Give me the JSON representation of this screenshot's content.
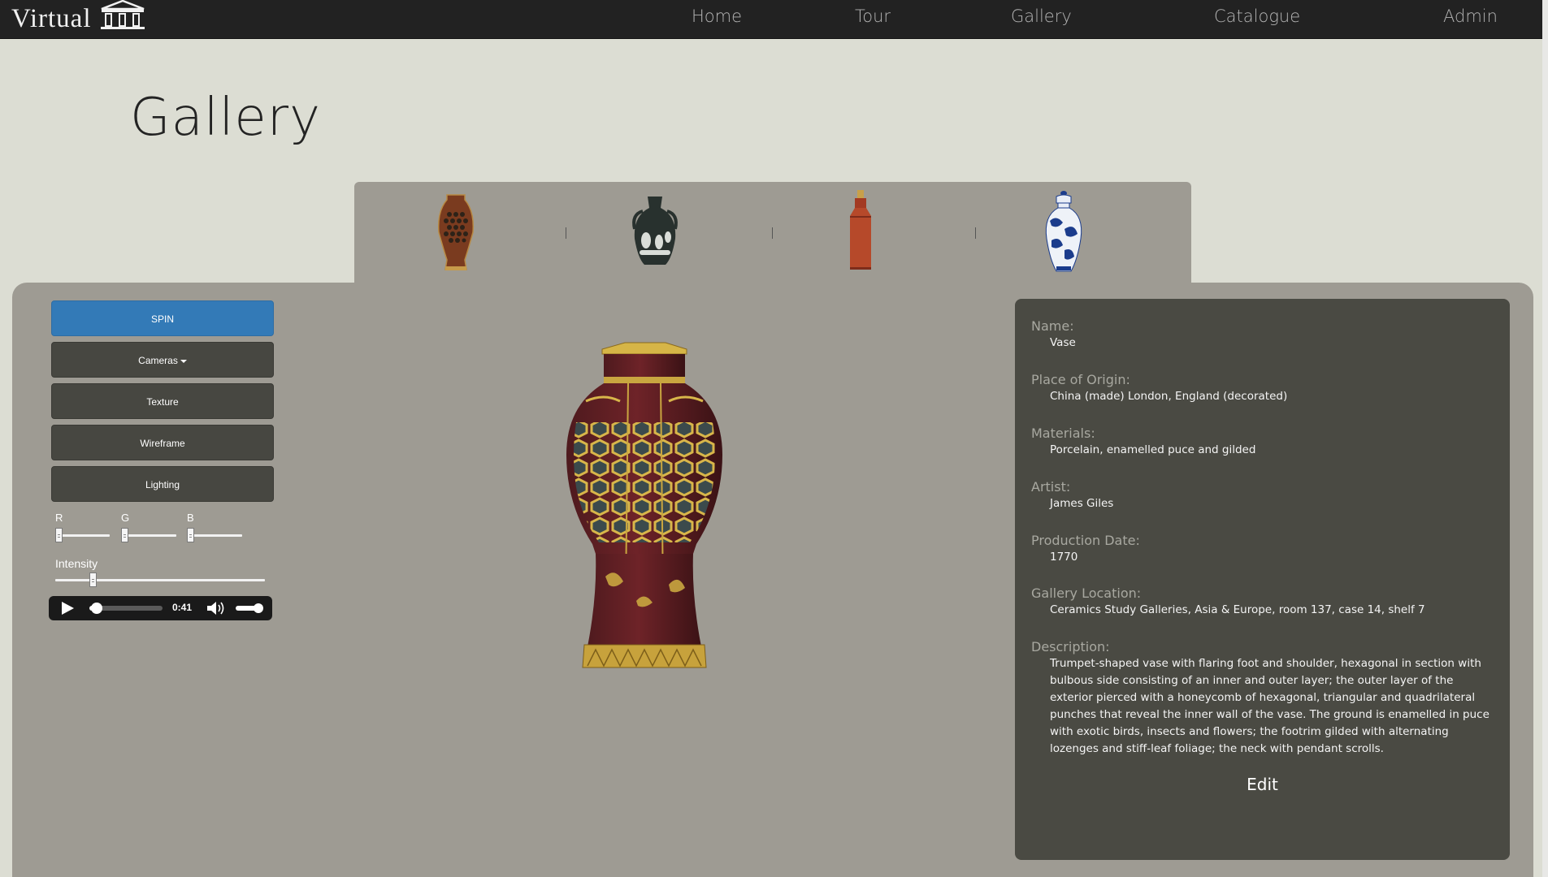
{
  "brand": {
    "name": "Virtual",
    "logo_icon": "museum-columns-icon"
  },
  "nav": {
    "items": [
      {
        "label": "Home"
      },
      {
        "label": "Tour"
      },
      {
        "label": "Gallery"
      },
      {
        "label": "Catalogue"
      },
      {
        "label": "Admin"
      }
    ]
  },
  "page": {
    "title": "Gallery"
  },
  "thumbnails": [
    {
      "name": "reticulated-vase",
      "icon": "vase-thumbnail"
    },
    {
      "name": "portland-vase",
      "icon": "vase-thumbnail"
    },
    {
      "name": "red-bottle",
      "icon": "bottle-thumbnail"
    },
    {
      "name": "blue-white-jar",
      "icon": "jar-thumbnail"
    }
  ],
  "controls": {
    "spin_label": "SPIN",
    "cameras_label": "Cameras",
    "texture_label": "Texture",
    "wireframe_label": "Wireframe",
    "lighting_label": "Lighting",
    "rgb": {
      "r_label": "R",
      "g_label": "G",
      "b_label": "B"
    },
    "intensity_label": "Intensity",
    "intensity_fraction": 0.18
  },
  "audio": {
    "time": "0:41",
    "progress_fraction": 0.1,
    "play_icon": "play-icon",
    "volume_icon": "volume-icon"
  },
  "info": {
    "name_label": "Name:",
    "name": "Vase",
    "origin_label": "Place of Origin:",
    "origin": "China (made) London, England (decorated)",
    "materials_label": "Materials:",
    "materials": "Porcelain, enamelled puce and gilded",
    "artist_label": "Artist:",
    "artist": "James Giles",
    "date_label": "Production Date:",
    "date": "1770",
    "location_label": "Gallery Location:",
    "location": "Ceramics Study Galleries, Asia & Europe, room 137, case 14, shelf 7",
    "description_label": "Description:",
    "description": "Trumpet-shaped vase with flaring foot and shoulder, hexagonal in section with bulbous side consisting of an inner and outer layer; the outer layer of the exterior pierced with a honeycomb of hexagonal, triangular and quadrilateral punches that reveal the inner wall of the vase. The ground is enamelled in puce with exotic birds, insects and flowers; the footrim gilded with alternating lozenges and stiff-leaf foliage; the neck with pendant scrolls.",
    "edit_label": "Edit"
  },
  "colors": {
    "navbar": "#222222",
    "page_bg": "#dcddd3",
    "panel_bg": "#9e9b93",
    "info_bg": "#4a4a43",
    "primary": "#337ab7"
  }
}
